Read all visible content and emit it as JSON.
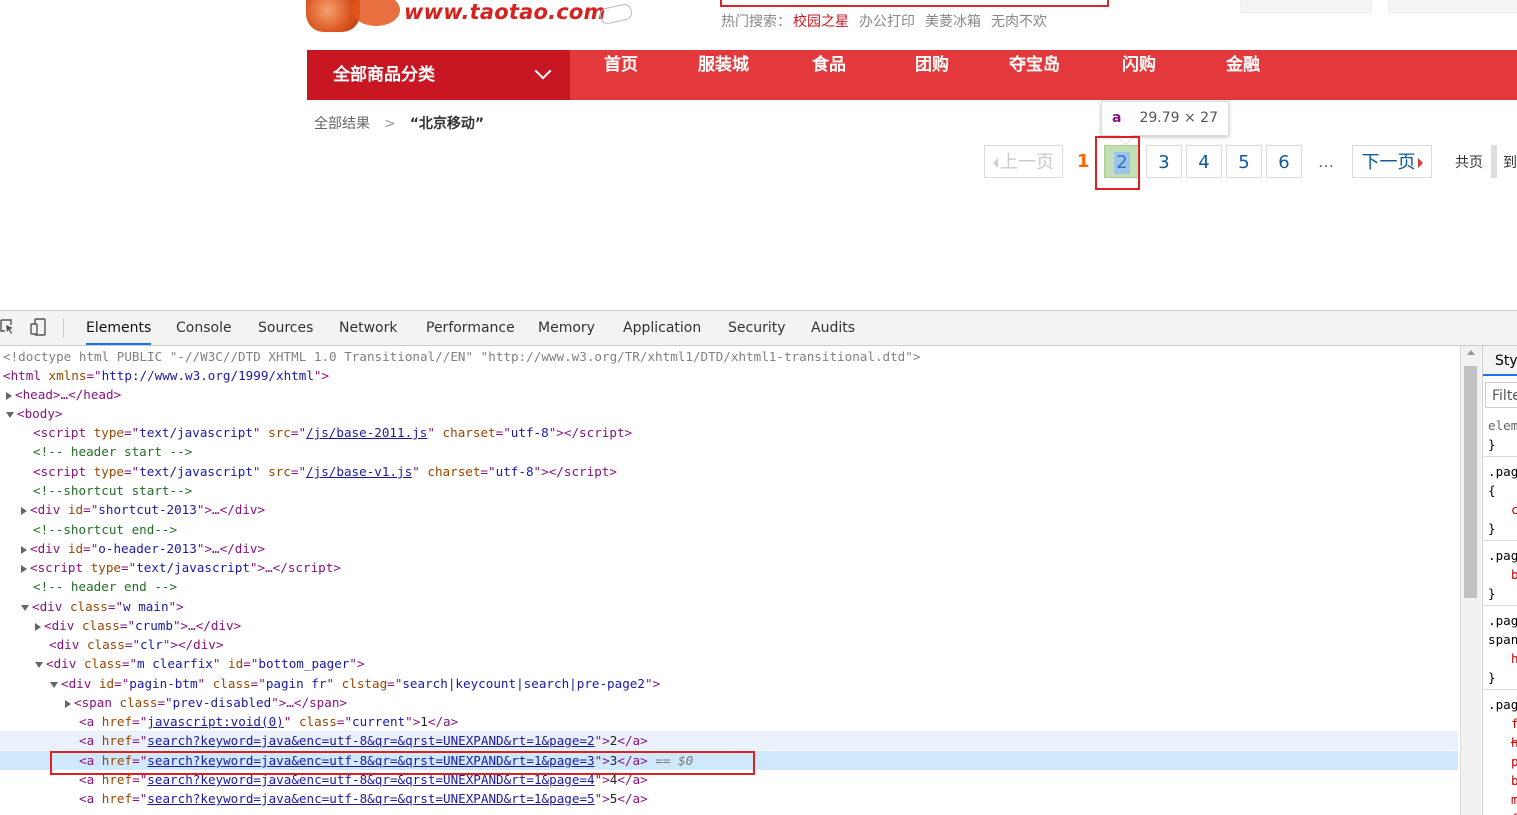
{
  "header": {
    "logo_text": "www.taotao.com",
    "hot_label": "热门搜索：",
    "hot_items": [
      "校园之星",
      "办公打印",
      "美菱冰箱",
      "无肉不欢"
    ]
  },
  "nav": {
    "category": "全部商品分类",
    "items": [
      "首页",
      "服装城",
      "食品",
      "团购",
      "夺宝岛",
      "闪购",
      "金融"
    ]
  },
  "crumb": {
    "root": "全部结果",
    "sep": ">",
    "keyword": "“北京移动”"
  },
  "tooltip": {
    "tag": "a",
    "dims": "29.79 × 27"
  },
  "pager": {
    "prev": "上一页",
    "current": "1",
    "pages": [
      "2",
      "3",
      "4",
      "5",
      "6"
    ],
    "ellipsis": "…",
    "next": "下一页",
    "total_label": "共页",
    "goto_label": "到"
  },
  "devtools": {
    "tabs": [
      "Elements",
      "Console",
      "Sources",
      "Network",
      "Performance",
      "Memory",
      "Application",
      "Security",
      "Audits"
    ],
    "active_tab": "Elements",
    "styles_tab": "Styl",
    "filter_placeholder": "Filte",
    "dom": {
      "doctype": "<!doctype html PUBLIC \"-//W3C//DTD XHTML 1.0 Transitional//EN\" \"http://www.w3.org/TR/xhtml1/DTD/xhtml1-transitional.dtd\">",
      "html_open": "<html",
      "html_attr": "xmlns",
      "html_val": "http://www.w3.org/1999/xhtml",
      "head": "<head>…</head>",
      "body": "<body>",
      "script1_src": "/js/base-2011.js",
      "script2_src": "/js/base-v1.js",
      "charset": "utf-8",
      "comment_header_start": "<!-- header start -->",
      "comment_shortcut_start": "<!--shortcut start-->",
      "comment_shortcut_end": "<!--shortcut end-->",
      "comment_header_end": "<!-- header end -->",
      "div_shortcut_id": "shortcut-2013",
      "div_oheader_id": "o-header-2013",
      "script_type": "text/javascript",
      "div_main_class": "w main",
      "div_crumb_class": "crumb",
      "div_clr_class": "clr",
      "div_pager_class": "m clearfix",
      "div_pager_id": "bottom_pager",
      "pagin_id": "pagin-btm",
      "pagin_class": "pagin fr",
      "pagin_clstag": "search|keycount|search|pre-page2",
      "span_class": "prev-disabled",
      "a_current_href": "javascript:void(0)",
      "a_current_class": "current",
      "a_current_text": "1",
      "links": [
        {
          "href": "search?keyword=java&enc=utf-8&qr=&qrst=UNEXPAND&rt=1&page=2",
          "text": "2"
        },
        {
          "href": "search?keyword=java&enc=utf-8&qr=&qrst=UNEXPAND&rt=1&page=3",
          "text": "3"
        },
        {
          "href": "search?keyword=java&enc=utf-8&qr=&qrst=UNEXPAND&rt=1&page=4",
          "text": "4"
        },
        {
          "href": "search?keyword=java&enc=utf-8&qr=&qrst=UNEXPAND&rt=1&page=5",
          "text": "5"
        }
      ],
      "selected_marker": "== $0"
    },
    "styles_lines": [
      "elem",
      "}",
      ".pag",
      "{",
      "c",
      "}",
      ".pag",
      "b",
      "}",
      ".pag",
      "span",
      "h",
      "}",
      ".pag",
      "f",
      "h",
      "p",
      "b",
      "m",
      "f"
    ]
  }
}
